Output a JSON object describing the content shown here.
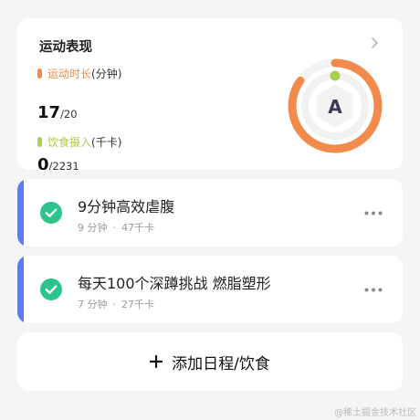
{
  "summary": {
    "title": "运动表现",
    "duration": {
      "label": "运动时长",
      "unit": "(分钟)",
      "value": "17",
      "total": "/20",
      "color": "#f18a4b",
      "progress": 0.85
    },
    "food": {
      "label": "饮食摄入",
      "unit": "(千卡)",
      "value": "0",
      "total": "/2231",
      "color": "#a8d150",
      "progress": 0.0
    },
    "grade": "A"
  },
  "tasks": [
    {
      "title": "9分钟高效虐腹",
      "duration": "9 分钟",
      "sep": "·",
      "calories": "47千卡",
      "done": true
    },
    {
      "title": "每天100个深蹲挑战 燃脂塑形",
      "duration": "7 分钟",
      "sep": "·",
      "calories": "27千卡",
      "done": true
    }
  ],
  "add": {
    "label": "添加日程/饮食"
  },
  "watermark": "@稀土掘金技术社区",
  "colors": {
    "accent_bar": "#5b7cf6",
    "check": "#2bc48a",
    "background": "#f4f5f6"
  }
}
